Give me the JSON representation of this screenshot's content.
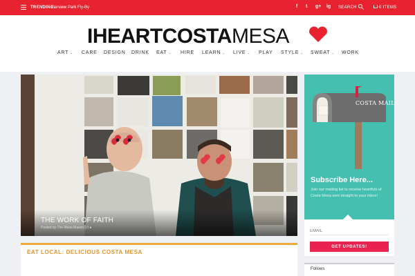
{
  "topbar": {
    "trending_label": "TRENDING:",
    "trending_link": "Fairview Park Fly-By",
    "social": [
      "f",
      "t",
      "g+",
      "ig"
    ],
    "search_label": "SEARCH",
    "cart_label": "0 ITEMS"
  },
  "logo": {
    "part1": "IHEART",
    "part2": "COSTA",
    "part3": "MESA"
  },
  "nav": [
    {
      "label": "ART",
      "dropdown": true
    },
    {
      "label": "CARE",
      "dropdown": false
    },
    {
      "label": "DESIGN",
      "dropdown": false
    },
    {
      "label": "DRINK",
      "dropdown": false
    },
    {
      "label": "EAT",
      "dropdown": true
    },
    {
      "label": "HIRE",
      "dropdown": false
    },
    {
      "label": "LEARN",
      "dropdown": true
    },
    {
      "label": "LIVE",
      "dropdown": true
    },
    {
      "label": "PLAY",
      "dropdown": false
    },
    {
      "label": "STYLE",
      "dropdown": true
    },
    {
      "label": "SWEAT",
      "dropdown": true
    },
    {
      "label": "WORK",
      "dropdown": false
    }
  ],
  "hero": {
    "title": "THE WORK OF FAITH",
    "meta": "Posted by The Mesa Maven | 0 ●"
  },
  "section": {
    "title": "EAT LOCAL: DELICIOUS COSTA MESA"
  },
  "widget": {
    "mail_label": "COSTA MAIL",
    "title": "Subscribe Here...",
    "text": "Join our mailing list to receive heartfuls of Costa Mesa sent straight to your inbox!",
    "email_placeholder": "EMAIL",
    "button_label": "GET UPDATES!"
  },
  "follows": {
    "label": "Follows"
  },
  "colors": {
    "brand_red": "#e8232f",
    "teal": "#45bfb0",
    "accent_orange": "#e8932a",
    "button_pink": "#e8234f"
  }
}
